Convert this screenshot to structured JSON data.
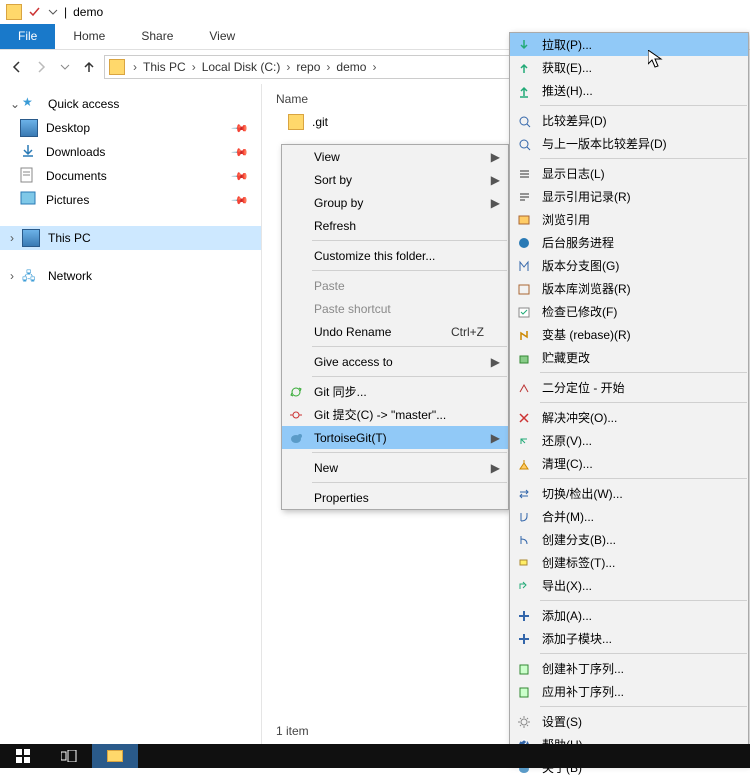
{
  "window": {
    "title": "demo",
    "divider": "|"
  },
  "ribbon": {
    "file": "File",
    "tabs": [
      "Home",
      "Share",
      "View"
    ]
  },
  "breadcrumb": {
    "items": [
      "This PC",
      "Local Disk (C:)",
      "repo",
      "demo"
    ]
  },
  "sidebar": {
    "quick_access": {
      "label": "Quick access",
      "items": [
        {
          "label": "Desktop",
          "pinned": true
        },
        {
          "label": "Downloads",
          "pinned": true
        },
        {
          "label": "Documents",
          "pinned": true
        },
        {
          "label": "Pictures",
          "pinned": true
        }
      ]
    },
    "this_pc": {
      "label": "This PC"
    },
    "network": {
      "label": "Network"
    }
  },
  "main": {
    "column_name": "Name",
    "items": [
      {
        "label": ".git"
      }
    ]
  },
  "status": {
    "text": "1 item"
  },
  "ctx1": {
    "view": "View",
    "sort": "Sort by",
    "group": "Group by",
    "refresh": "Refresh",
    "customize": "Customize this folder...",
    "paste": "Paste",
    "paste_shortcut": "Paste shortcut",
    "undo": "Undo Rename",
    "undo_sc": "Ctrl+Z",
    "give_access": "Give access to",
    "git_sync": "Git 同步...",
    "git_commit": "Git 提交(C) -> \"master\"...",
    "tortoise": "TortoiseGit(T)",
    "new": "New",
    "properties": "Properties"
  },
  "ctx2": {
    "items": [
      {
        "text": "拉取(P)...",
        "highlight": true,
        "icon": "pull"
      },
      {
        "text": "获取(E)...",
        "icon": "fetch"
      },
      {
        "text": "推送(H)...",
        "icon": "push"
      },
      {
        "sep": true
      },
      {
        "text": "比较差异(D)",
        "icon": "diff"
      },
      {
        "text": "与上一版本比较差异(D)",
        "icon": "diff"
      },
      {
        "sep": true
      },
      {
        "text": "显示日志(L)",
        "icon": "log"
      },
      {
        "text": "显示引用记录(R)",
        "icon": "reflog"
      },
      {
        "text": "浏览引用",
        "icon": "browse"
      },
      {
        "text": "后台服务进程",
        "icon": "daemon"
      },
      {
        "text": "版本分支图(G)",
        "icon": "graph"
      },
      {
        "text": "版本库浏览器(R)",
        "icon": "repo"
      },
      {
        "text": "检查已修改(F)",
        "icon": "check"
      },
      {
        "text": "变基 (rebase)(R)",
        "icon": "rebase"
      },
      {
        "text": "贮藏更改",
        "icon": "stash"
      },
      {
        "sep": true
      },
      {
        "text": "二分定位 - 开始",
        "icon": "bisect"
      },
      {
        "sep": true
      },
      {
        "text": "解决冲突(O)...",
        "icon": "resolve"
      },
      {
        "text": "还原(V)...",
        "icon": "revert"
      },
      {
        "text": "清理(C)...",
        "icon": "clean"
      },
      {
        "sep": true
      },
      {
        "text": "切换/检出(W)...",
        "icon": "switch"
      },
      {
        "text": "合并(M)...",
        "icon": "merge"
      },
      {
        "text": "创建分支(B)...",
        "icon": "branch"
      },
      {
        "text": "创建标签(T)...",
        "icon": "tag"
      },
      {
        "text": "导出(X)...",
        "icon": "export"
      },
      {
        "sep": true
      },
      {
        "text": "添加(A)...",
        "icon": "add"
      },
      {
        "text": "添加子模块...",
        "icon": "submodule"
      },
      {
        "sep": true
      },
      {
        "text": "创建补丁序列...",
        "icon": "patch"
      },
      {
        "text": "应用补丁序列...",
        "icon": "apply"
      },
      {
        "sep": true
      },
      {
        "text": "设置(S)",
        "icon": "settings"
      },
      {
        "text": "帮助(H)",
        "icon": "help"
      },
      {
        "text": "关于(B)",
        "icon": "about"
      }
    ]
  }
}
